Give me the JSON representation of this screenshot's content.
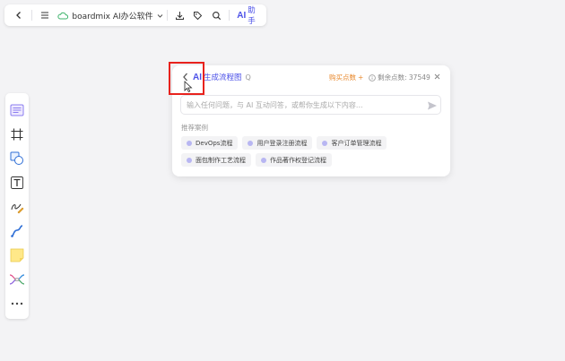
{
  "topbar": {
    "doc_name": "boardmix AI办公软件",
    "ai_logo": "AI",
    "ai_label": "助手"
  },
  "toolbar": {
    "tools": [
      "template-icon",
      "frame-icon",
      "shape-icon",
      "text-icon",
      "pen-icon",
      "connector-icon",
      "sticky-note-icon",
      "mindmap-icon",
      "more-icon"
    ],
    "more_label": "···"
  },
  "panel": {
    "ai_logo": "AI",
    "title": "生成流程图",
    "q": "Q",
    "buy_label": "购买点数",
    "buy_plus": "+",
    "remaining_label": "剩余点数: 37549",
    "input_placeholder": "输入任何问题，与 AI 互动问答，或帮你生成以下内容...",
    "recommend_label": "推荐案例",
    "chips_row1": [
      "DevOps流程",
      "用户登录注册流程",
      "客户订单管理流程"
    ],
    "chips_row2": [
      "面包制作工艺流程",
      "作品著作权登记流程"
    ]
  },
  "colors": {
    "accent": "#4d52e8",
    "buy": "#e8892d",
    "highlight": "#e8221d"
  }
}
